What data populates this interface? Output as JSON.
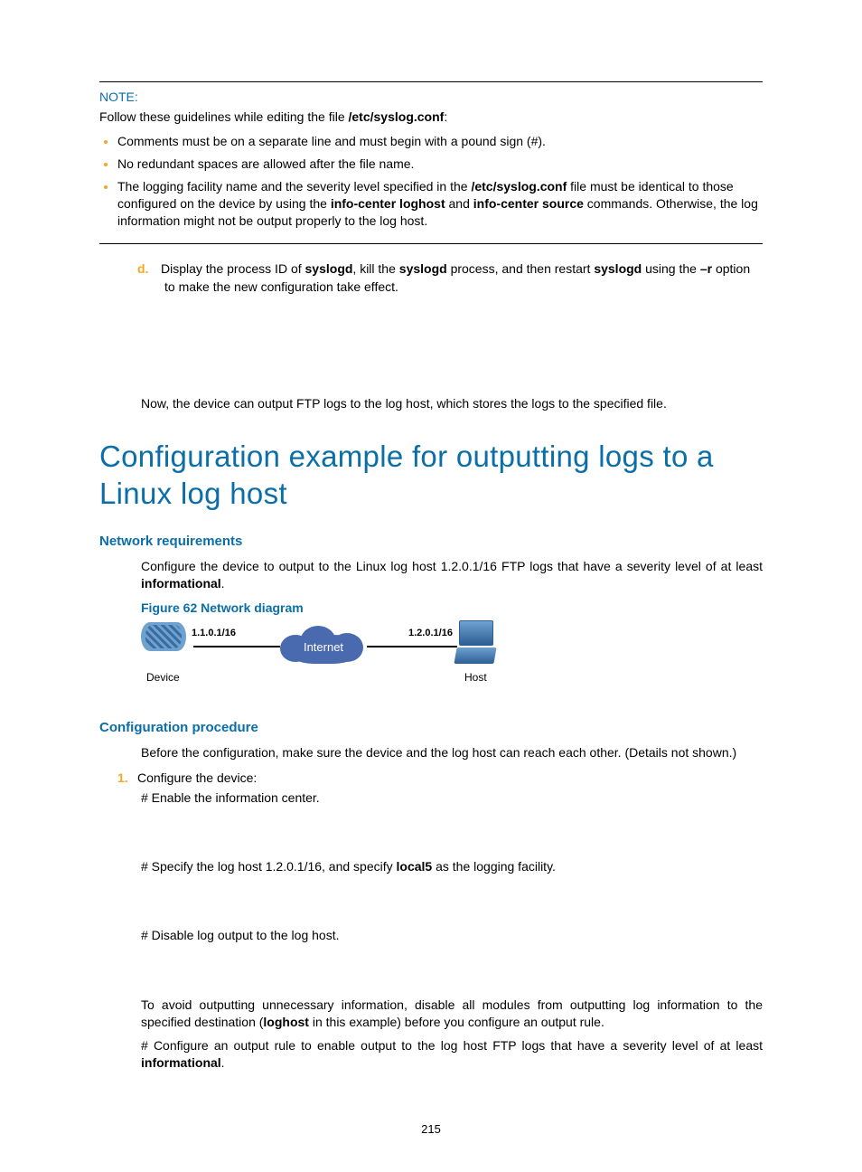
{
  "note": {
    "label": "NOTE:",
    "intro_pre": "Follow these guidelines while editing the file ",
    "intro_file": "/etc/syslog.conf",
    "intro_post": ":",
    "bullet1": "Comments must be on a separate line and must begin with a pound sign (#).",
    "bullet2": "No redundant spaces are allowed after the file name.",
    "bullet3_pre": "The logging facility name and the severity level specified in the ",
    "bullet3_file": "/etc/syslog.conf",
    "bullet3_mid": " file must be identical to those configured on the device by using the ",
    "bullet3_cmd1": "info-center loghost",
    "bullet3_and": " and ",
    "bullet3_cmd2": "info-center source",
    "bullet3_post": " commands. Otherwise, the log information might not be output properly to the log host."
  },
  "step_d": {
    "label": "d.",
    "t1": "Display the process ID of ",
    "b1": "syslogd",
    "t2": ", kill the ",
    "b2": "syslogd",
    "t3": " process, and then restart ",
    "b3": "syslogd",
    "t4": " using the ",
    "b4": "–r",
    "t5": " option to make the new configuration take effect."
  },
  "summary": "Now, the device can output FTP logs to the log host, which stores the logs to the specified file.",
  "h1": "Configuration example for outputting logs to a Linux log host",
  "netreq": {
    "heading": "Network requirements",
    "para_pre": "Configure the device to output to the Linux log host 1.2.0.1/16 FTP logs that have a severity level of at least ",
    "para_bold": "informational",
    "para_post": "."
  },
  "figure": {
    "caption": "Figure 62 Network diagram",
    "ip_left": "1.1.0.1/16",
    "ip_right": "1.2.0.1/16",
    "cloud": "Internet",
    "device": "Device",
    "host": "Host"
  },
  "proc": {
    "heading": "Configuration procedure",
    "intro": "Before the configuration, make sure the device and the log host can reach each other. (Details not shown.)",
    "step1_num": "1.",
    "step1_label": "Configure the device:",
    "s1a": "# Enable the information center.",
    "s1b_pre": "# Specify the log host 1.2.0.1/16, and specify ",
    "s1b_bold": "local5",
    "s1b_post": " as the logging facility.",
    "s1c": "# Disable log output to the log host.",
    "s1d_pre": "To avoid outputting unnecessary information, disable all modules from outputting log information to the specified destination (",
    "s1d_bold": "loghost",
    "s1d_post": " in this example) before you configure an output rule.",
    "s1e_pre": "# Configure an output rule to enable output to the log host FTP logs that have a severity level of at least ",
    "s1e_bold": "informational",
    "s1e_post": "."
  },
  "page_number": "215"
}
